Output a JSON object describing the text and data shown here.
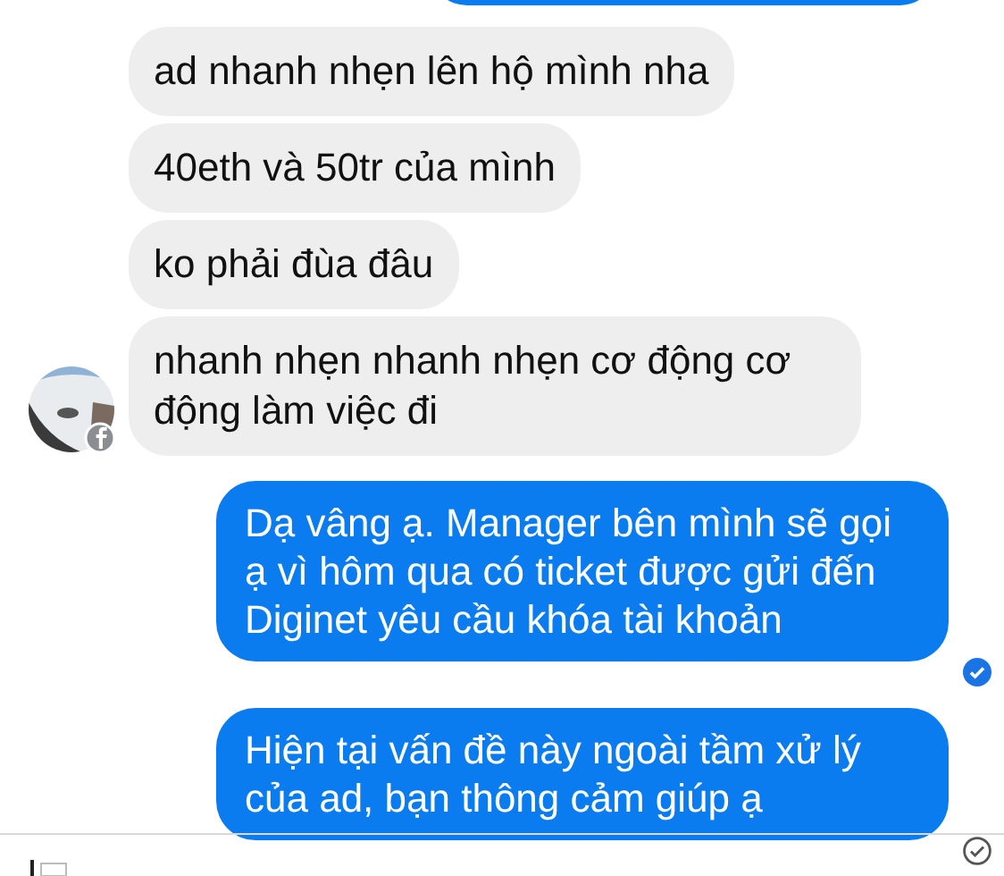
{
  "messages": [
    {
      "kind": "received",
      "text": "ad nhanh nhẹn lên hộ mình nha"
    },
    {
      "kind": "received",
      "text": "40eth và 50tr của mình"
    },
    {
      "kind": "received",
      "text": "ko phải đùa đâu"
    },
    {
      "kind": "received",
      "text": "nhanh nhẹn nhanh nhẹn cơ động cơ động làm việc đi",
      "avatar": true
    },
    {
      "kind": "sent",
      "text": "Dạ vâng ạ. Manager bên mình sẽ gọi ạ vì hôm qua có ticket được gửi đến Diginet yêu cầu khóa tài khoản",
      "seen": true
    },
    {
      "kind": "sent",
      "text": "Hiện tại vấn đề này ngoài tầm xử lý của ad, bạn thông cảm giúp ạ",
      "seen": false
    }
  ]
}
